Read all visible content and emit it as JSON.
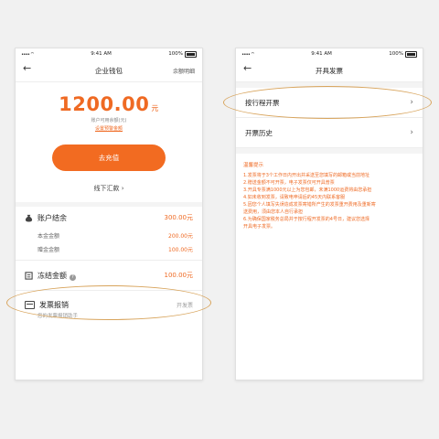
{
  "left": {
    "status": {
      "time": "9:41 AM",
      "battery": "100%"
    },
    "nav": {
      "title": "企业钱包",
      "right": "余额明细"
    },
    "balance": {
      "amount": "1200.00",
      "unit": "元",
      "available": "账户可用余额(元)",
      "setting_link": "设置预警金额"
    },
    "recharge_label": "去充值",
    "offline_label": "线下汇款 ›",
    "account": {
      "label": "账户结余",
      "value": "300.00元"
    },
    "sub_rows": [
      {
        "label": "本金金额",
        "value": "200.00元"
      },
      {
        "label": "赠金金额",
        "value": "100.00元"
      }
    ],
    "frozen": {
      "label": "冻结金额",
      "value": "100.00元"
    },
    "invoice": {
      "label": "发票报销",
      "right": "开发票",
      "sub": "您的发票报销助手"
    }
  },
  "right": {
    "status": {
      "time": "9:41 AM",
      "battery": "100%"
    },
    "nav": {
      "title": "开具发票"
    },
    "menu": [
      {
        "label": "按行程开票"
      },
      {
        "label": "开票历史"
      }
    ],
    "notice": {
      "title": "温馨提示",
      "lines": [
        "1.发票将于3个工作日内开出并采送至您填写的邮箱或当前地址",
        "2.赠送金额不可开票，电子发票仅可开具普票",
        "3.开具专票满1000元以上为您包邮，未满1000运费将由您承担",
        "4.如未收到发票，请致电申请后的45天内联系客服",
        "5.因您个人填写失误造成发票寄错所产生的发票重开费用及重新寄",
        "   送费用，须由您本人自行承担",
        "6.为确保国家税务总局并于按行程开发票的4号日，建议您选择",
        "   开具电子发票。"
      ]
    }
  }
}
